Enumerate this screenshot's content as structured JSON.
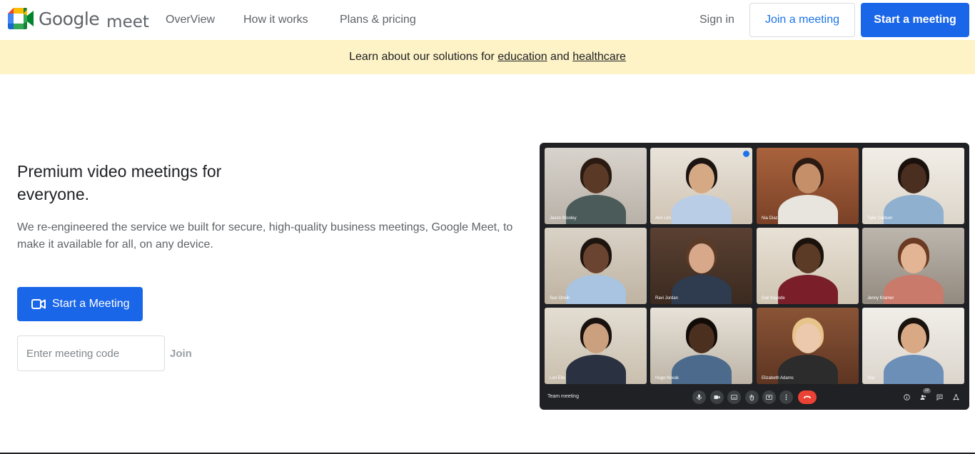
{
  "brand": {
    "google": "Google",
    "product": "meet"
  },
  "nav": {
    "overview": "OverView",
    "how_it_works": "How it works",
    "plans": "Plans & pricing"
  },
  "header_actions": {
    "sign_in": "Sign in",
    "join": "Join a meeting",
    "start": "Start a meeting"
  },
  "banner": {
    "prefix": "Learn about our solutions for ",
    "link1": "education",
    "middle": " and ",
    "link2": "healthcare"
  },
  "hero": {
    "title": "Premium video meetings for everyone.",
    "description": "We re-engineered the service we built for secure, high-quality business meetings, Google Meet, to make it available for all, on any device.",
    "start_button": "Start a Meeting",
    "code_placeholder": "Enter meeting code",
    "join_label": "Join"
  },
  "meeting": {
    "title": "Team meeting",
    "participant_count": "12",
    "participants": [
      "Jason Wooley",
      "Ann Lim",
      "Nia Diaz",
      "Tyler Carlson",
      "Sue Oneill",
      "Ravi Jordan",
      "Gail Kayode",
      "Jenny Kramer",
      "Lori Elle",
      "Hugo Novak",
      "Elizabeth Adams",
      "You"
    ]
  },
  "colors": {
    "accent": "#1a66e8",
    "banner": "#fef3c7",
    "end_call": "#ea4335",
    "window": "#202124"
  }
}
